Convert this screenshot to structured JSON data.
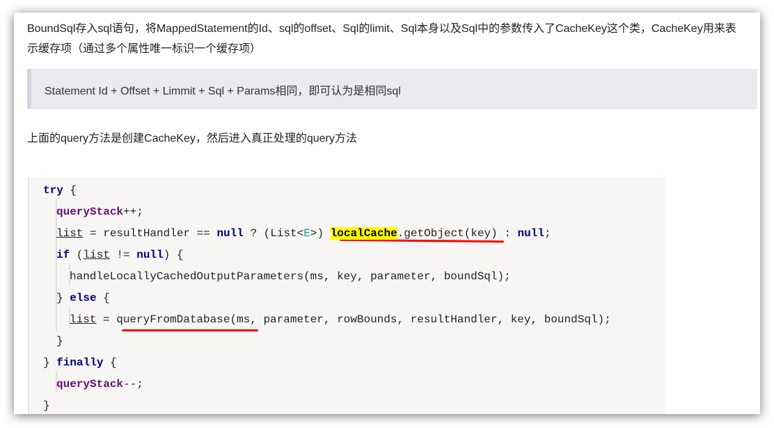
{
  "article": {
    "paragraph1": "BoundSql存入sql语句，将MappedStatement的Id、sql的offset、Sql的limit、Sql本身以及Sql中的参数传入了CacheKey这个类，CacheKey用来表示缓存项（通过多个属性唯一标识一个缓存项）",
    "quote": "Statement Id + Offset + Limmit + Sql + Params相同，即可认为是相同sql",
    "paragraph2": "上面的query方法是创建CacheKey，然后进入真正处理的query方法"
  },
  "code": {
    "highlight_color": "#ffff00",
    "annotation_color": "#ff0000",
    "lines": [
      {
        "indent": 0,
        "tokens": [
          {
            "t": "try",
            "c": "kw"
          },
          {
            "t": " {"
          }
        ]
      },
      {
        "indent": 1,
        "tokens": [
          {
            "t": "queryStack",
            "c": "fld"
          },
          {
            "t": "++;"
          }
        ]
      },
      {
        "indent": 1,
        "tokens": [
          {
            "t": "list",
            "c": "ul"
          },
          {
            "t": " = resultHandler == "
          },
          {
            "t": "null",
            "c": "kw"
          },
          {
            "t": " ? (List<"
          },
          {
            "t": "E",
            "c": "tp"
          },
          {
            "t": ">) "
          },
          {
            "t": "localCache",
            "c": "hl"
          },
          {
            "t": ".getObject(key) : "
          },
          {
            "t": "null",
            "c": "kw"
          },
          {
            "t": ";"
          }
        ]
      },
      {
        "indent": 1,
        "tokens": [
          {
            "t": "if",
            "c": "kw"
          },
          {
            "t": " ("
          },
          {
            "t": "list",
            "c": "ul"
          },
          {
            "t": " != "
          },
          {
            "t": "null",
            "c": "kw"
          },
          {
            "t": ") {"
          }
        ]
      },
      {
        "indent": 2,
        "tokens": [
          {
            "t": "handleLocallyCachedOutputParameters(ms, key, parameter, boundSql);"
          }
        ]
      },
      {
        "indent": 1,
        "tokens": [
          {
            "t": "} "
          },
          {
            "t": "else",
            "c": "kw"
          },
          {
            "t": " {"
          }
        ]
      },
      {
        "indent": 2,
        "tokens": [
          {
            "t": "list",
            "c": "ul"
          },
          {
            "t": " = queryFromDatabase(ms, parameter, rowBounds, resultHandler, key, boundSql);"
          }
        ]
      },
      {
        "indent": 1,
        "tokens": [
          {
            "t": "}"
          }
        ]
      },
      {
        "indent": 0,
        "tokens": [
          {
            "t": "} "
          },
          {
            "t": "finally",
            "c": "kw"
          },
          {
            "t": " {"
          }
        ]
      },
      {
        "indent": 1,
        "tokens": [
          {
            "t": "queryStack",
            "c": "fld"
          },
          {
            "t": "--;"
          }
        ]
      },
      {
        "indent": 0,
        "tokens": [
          {
            "t": "}"
          }
        ]
      }
    ]
  }
}
